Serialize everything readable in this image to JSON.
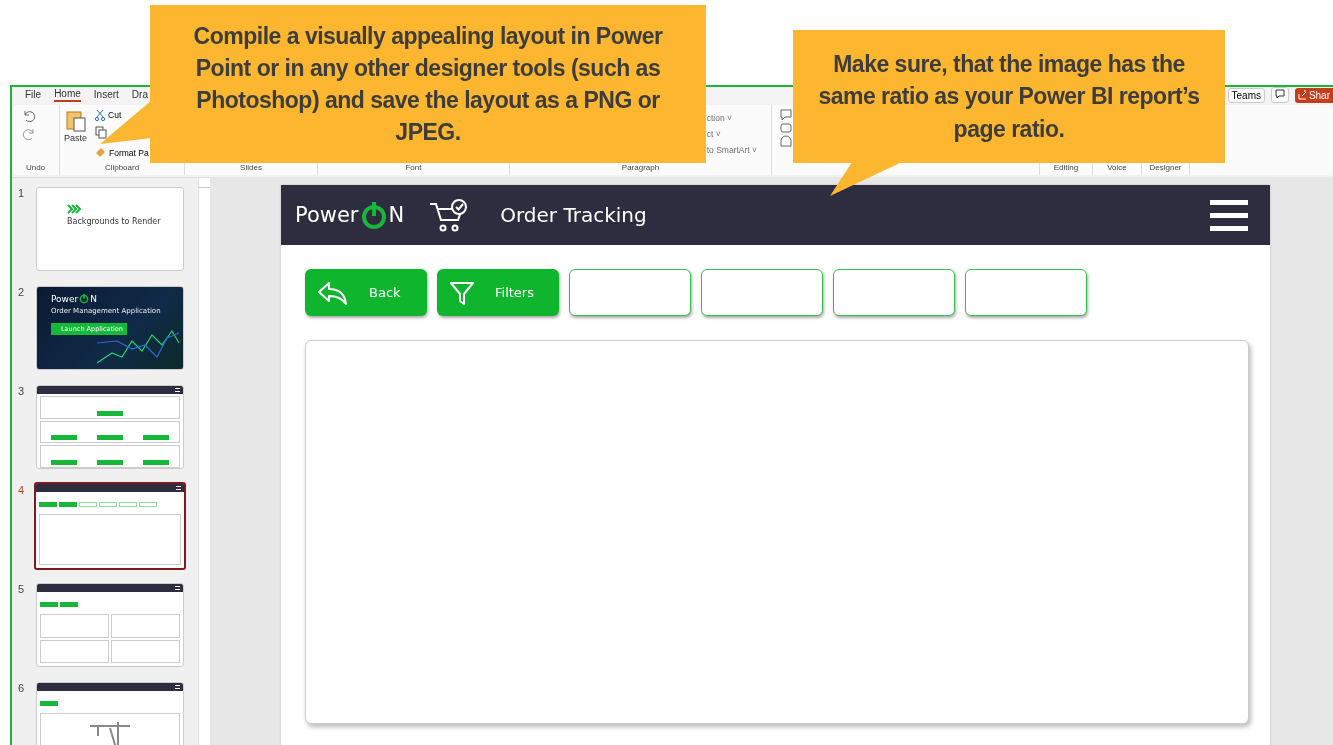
{
  "ribbon": {
    "tabs": [
      {
        "label": "File",
        "selected": false
      },
      {
        "label": "Home",
        "selected": true
      },
      {
        "label": "Insert",
        "selected": false
      },
      {
        "label": "Dra",
        "selected": false
      }
    ],
    "teams": "Teams",
    "share": "Shar",
    "groups": [
      {
        "kind": "undo",
        "label": "Undo"
      },
      {
        "kind": "clipboard",
        "label": "Clipboard",
        "paste": "Paste",
        "cut": "Cut",
        "format": "Format Pa"
      },
      {
        "kind": "plain",
        "label": "Slides"
      },
      {
        "kind": "plain",
        "label": "Font"
      },
      {
        "kind": "paragraph",
        "label": "Paragraph",
        "items": [
          "ction ˅",
          "ct ˅",
          "to SmartArt ˅"
        ]
      },
      {
        "kind": "drawing"
      },
      {
        "kind": "plain",
        "label": "Editing"
      },
      {
        "kind": "plain",
        "label": "Voice"
      },
      {
        "kind": "plain",
        "label": "Designer"
      }
    ]
  },
  "thumbnails": [
    {
      "number": "1",
      "selected": false,
      "kind": "title",
      "title": "Backgrounds to Render"
    },
    {
      "number": "2",
      "selected": false,
      "kind": "cover",
      "brand": "Power",
      "brand_end": "N",
      "title": "Order Management Application",
      "button": "Launch Application"
    },
    {
      "number": "3",
      "selected": false,
      "kind": "menu"
    },
    {
      "number": "4",
      "selected": true,
      "kind": "tracking"
    },
    {
      "number": "5",
      "selected": false,
      "kind": "grid"
    },
    {
      "number": "6",
      "selected": false,
      "kind": "construction"
    }
  ],
  "slide": {
    "brand": "Power",
    "brand_end": "N",
    "title": "Order Tracking",
    "buttons": [
      {
        "kind": "back",
        "label": "Back"
      },
      {
        "kind": "filter",
        "label": "Filters"
      },
      {
        "kind": "blank"
      },
      {
        "kind": "blank"
      },
      {
        "kind": "blank"
      },
      {
        "kind": "blank"
      }
    ]
  },
  "callouts": [
    {
      "kind": "left",
      "text": "Compile a visually appealing layout in Power Point or in any other designer tools (such as Photoshop) and save the layout as a PNG or JPEG."
    },
    {
      "kind": "right",
      "text": "Make sure, that the image has the same ratio as your Power BI report’s page ratio."
    }
  ]
}
